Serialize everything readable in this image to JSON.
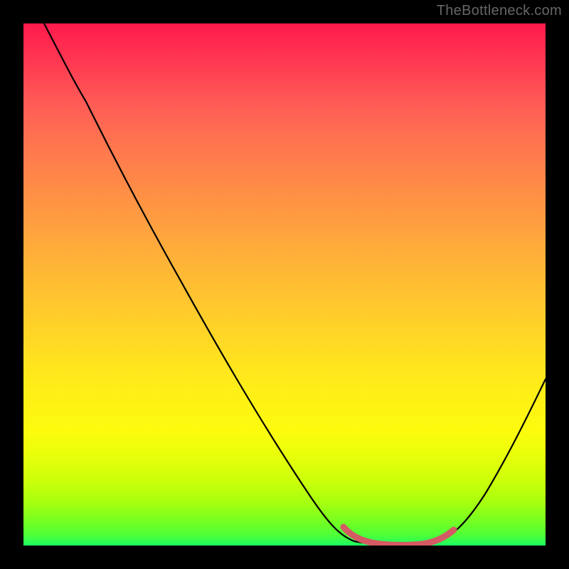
{
  "watermark": {
    "text": "TheBottleneck.com"
  },
  "chart_data": {
    "type": "line",
    "title": "",
    "xlabel": "",
    "ylabel": "",
    "xlim": [
      0,
      100
    ],
    "ylim": [
      0,
      100
    ],
    "grid": false,
    "legend": false,
    "series": [
      {
        "name": "bottleneck-curve",
        "color": "#000000",
        "x": [
          4,
          8,
          12,
          16,
          20,
          24,
          30,
          36,
          42,
          48,
          54,
          58,
          62,
          66,
          70,
          74,
          77,
          80,
          84,
          88,
          92,
          96,
          100
        ],
        "values": [
          100,
          94,
          89,
          84,
          79,
          73,
          64,
          55,
          46,
          37,
          28,
          22,
          15,
          9,
          4,
          1,
          0,
          0,
          2,
          8,
          17,
          27,
          37
        ]
      },
      {
        "name": "optimal-range-marker",
        "color": "#d45a63",
        "x": [
          62,
          64,
          66,
          68,
          70,
          72,
          74,
          76,
          78,
          80,
          82,
          84
        ],
        "values": [
          5,
          3,
          1.5,
          0.8,
          0.4,
          0.2,
          0.2,
          0.3,
          0.6,
          1.2,
          2.4,
          4.2
        ]
      }
    ],
    "background_gradient": {
      "top_color": "#ff1a4d",
      "bottom_color": "#1cff64",
      "stops": [
        {
          "pct": 0,
          "color": "#ff1a4d"
        },
        {
          "pct": 50,
          "color": "#ffc82e"
        },
        {
          "pct": 80,
          "color": "#fdfb0e"
        },
        {
          "pct": 100,
          "color": "#1cff64"
        }
      ]
    }
  }
}
